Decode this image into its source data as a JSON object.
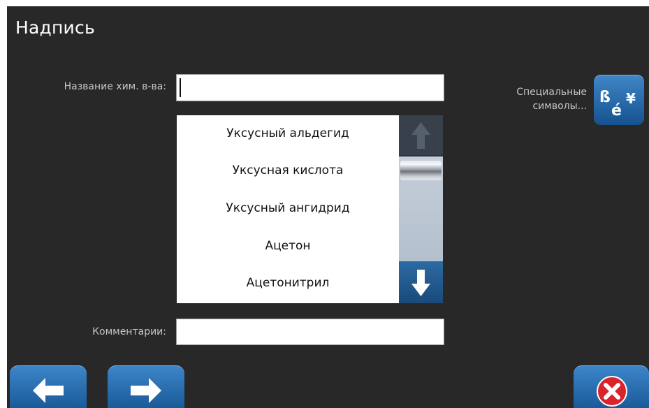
{
  "window": {
    "title": "Надпись"
  },
  "form": {
    "chemical_name_label": "Название хим. в-ва:",
    "chemical_name_value": "",
    "comment_label": "Комментарии:",
    "comment_value": ""
  },
  "chemical_list": {
    "items": [
      "Уксусный альдегид",
      "Уксусная кислота",
      "Уксусный ангидрид",
      "Ацетон",
      "Ацетонитрил"
    ]
  },
  "special_symbols": {
    "label_line1": "Специальные",
    "label_line2": "символы...",
    "button_glyphs": {
      "sharp_s": "ß",
      "e_acute": "é",
      "yen": "¥"
    }
  },
  "icons": {
    "scroll_up": "arrow-up-icon",
    "scroll_down": "arrow-down-icon",
    "back": "arrow-left-icon",
    "forward": "arrow-right-icon",
    "close": "close-icon"
  },
  "colors": {
    "panel_background": "#282828",
    "button_blue": "#2a70b1",
    "close_red": "#d8242a",
    "label_text": "#c4c4c4"
  }
}
